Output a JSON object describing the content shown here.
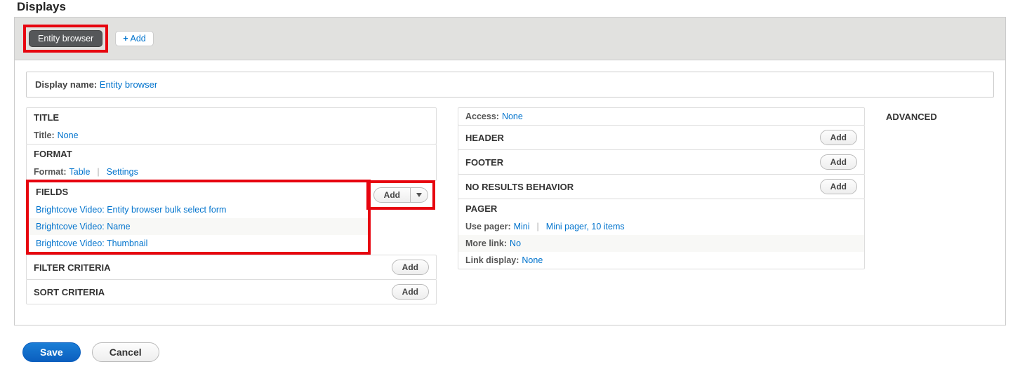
{
  "page_title": "Displays",
  "tabs": {
    "active": "Entity browser",
    "add_label": "Add"
  },
  "display_name": {
    "label": "Display name:",
    "value": "Entity browser"
  },
  "sections": {
    "title": {
      "heading": "TITLE",
      "row_label": "Title:",
      "row_value": "None"
    },
    "format": {
      "heading": "FORMAT",
      "row_label": "Format:",
      "row_value": "Table",
      "settings_label": "Settings"
    },
    "fields": {
      "heading": "FIELDS",
      "add_label": "Add",
      "items": [
        "Brightcove Video: Entity browser bulk select form",
        "Brightcove Video: Name",
        "Brightcove Video: Thumbnail"
      ]
    },
    "filter_criteria": {
      "heading": "FILTER CRITERIA",
      "add_label": "Add"
    },
    "sort_criteria": {
      "heading": "SORT CRITERIA",
      "add_label": "Add"
    },
    "access": {
      "label": "Access:",
      "value": "None"
    },
    "header": {
      "heading": "HEADER",
      "add_label": "Add"
    },
    "footer": {
      "heading": "FOOTER",
      "add_label": "Add"
    },
    "no_results": {
      "heading": "NO RESULTS BEHAVIOR",
      "add_label": "Add"
    },
    "pager": {
      "heading": "PAGER",
      "use_label": "Use pager:",
      "use_value": "Mini",
      "detail_value": "Mini pager, 10 items",
      "more_label": "More link:",
      "more_value": "No",
      "link_label": "Link display:",
      "link_value": "None"
    }
  },
  "advanced": {
    "heading": "ADVANCED"
  },
  "actions": {
    "save": "Save",
    "cancel": "Cancel"
  }
}
